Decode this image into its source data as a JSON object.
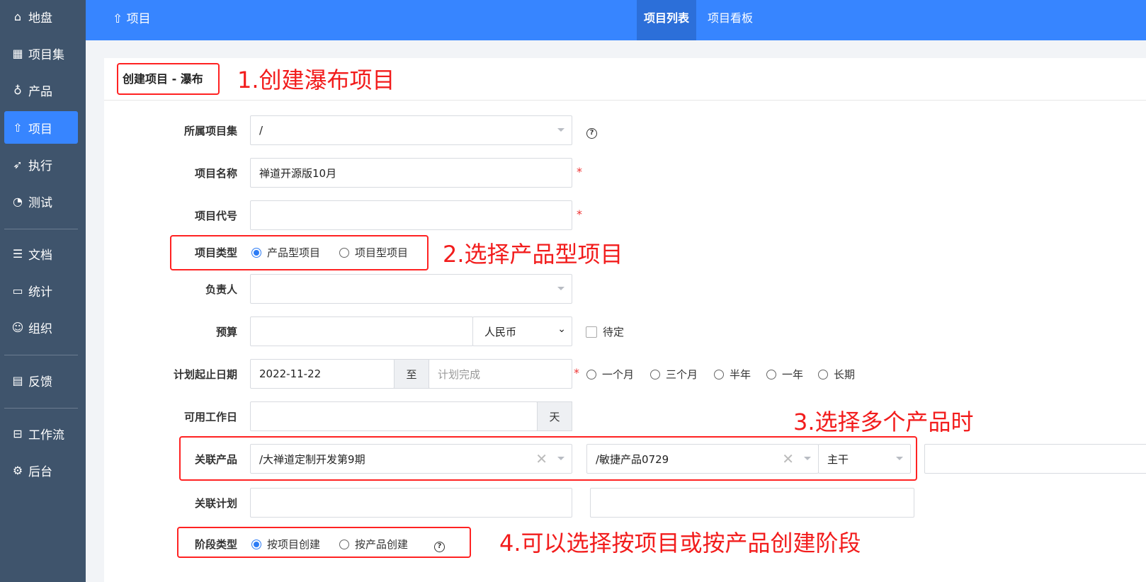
{
  "sidebar": {
    "items": [
      {
        "label": "地盘",
        "icon": "home-icon"
      },
      {
        "label": "项目集",
        "icon": "grid-icon"
      },
      {
        "label": "产品",
        "icon": "lightbulb-icon"
      },
      {
        "label": "项目",
        "icon": "rocket-icon"
      },
      {
        "label": "执行",
        "icon": "run-icon"
      },
      {
        "label": "测试",
        "icon": "search-icon"
      },
      {
        "label": "文档",
        "icon": "doc-icon"
      },
      {
        "label": "统计",
        "icon": "monitor-icon"
      },
      {
        "label": "组织",
        "icon": "user-icon"
      },
      {
        "label": "反馈",
        "icon": "feedback-icon"
      },
      {
        "label": "工作流",
        "icon": "workflow-icon"
      },
      {
        "label": "后台",
        "icon": "gear-icon"
      }
    ]
  },
  "topbar": {
    "crumb": "项目",
    "tabs": [
      "项目列表",
      "项目看板"
    ]
  },
  "form": {
    "title": "创建项目 - 瀑布",
    "program_label": "所属项目集",
    "program_value": "/",
    "name_label": "项目名称",
    "name_value": "禅道开源版10月",
    "code_label": "项目代号",
    "code_value": "",
    "type_label": "项目类型",
    "type_options": [
      "产品型项目",
      "项目型项目"
    ],
    "owner_label": "负责人",
    "budget_label": "预算",
    "currency": "人民币",
    "tbd": "待定",
    "date_label": "计划起止日期",
    "begin": "2022-11-22",
    "to": "至",
    "end_placeholder": "计划完成",
    "durations": [
      "一个月",
      "三个月",
      "半年",
      "一年",
      "长期"
    ],
    "workdays_label": "可用工作日",
    "days_unit": "天",
    "products_label": "关联产品",
    "product1": "/大禅道定制开发第9期",
    "product2": "/敏捷产品0729",
    "branch": "主干",
    "plans_label": "关联计划",
    "stage_label": "阶段类型",
    "stage_options": [
      "按项目创建",
      "按产品创建"
    ],
    "required_mark": "*",
    "help": "?",
    "clear": "✕"
  },
  "annotations": [
    "1.创建瀑布项目",
    "2.选择产品型项目",
    "3.选择多个产品时",
    "4.可以选择按项目或按产品创建阶段"
  ]
}
